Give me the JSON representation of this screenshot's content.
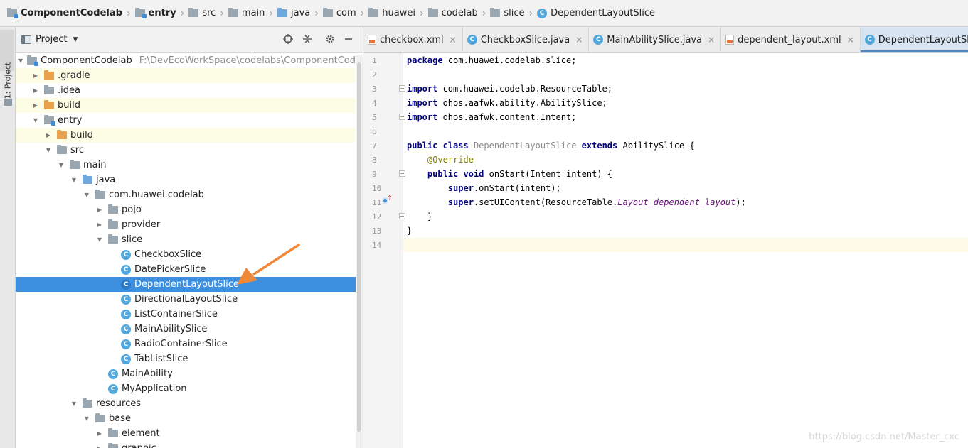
{
  "breadcrumb": [
    {
      "label": "ComponentCodelab",
      "icon": "module-folder-icon",
      "bold": true
    },
    {
      "label": "entry",
      "icon": "module-folder-icon",
      "bold": true
    },
    {
      "label": "src",
      "icon": "folder-icon"
    },
    {
      "label": "main",
      "icon": "folder-icon"
    },
    {
      "label": "java",
      "icon": "source-folder-icon"
    },
    {
      "label": "com",
      "icon": "package-icon"
    },
    {
      "label": "huawei",
      "icon": "package-icon"
    },
    {
      "label": "codelab",
      "icon": "package-icon"
    },
    {
      "label": "slice",
      "icon": "package-icon"
    },
    {
      "label": "DependentLayoutSlice",
      "icon": "class-icon"
    }
  ],
  "left_strip": {
    "label": "1: Project"
  },
  "project_panel": {
    "title": "Project",
    "tree": [
      {
        "label": "ComponentCodelab",
        "path": "F:\\DevEcoWorkSpace\\codelabs\\ComponentCodelab",
        "depth": 0,
        "arrow": "open",
        "icon": "module",
        "highlight": false
      },
      {
        "label": ".gradle",
        "depth": 1,
        "arrow": "closed",
        "icon": "orange",
        "highlight": true
      },
      {
        "label": ".idea",
        "depth": 1,
        "arrow": "closed",
        "icon": "folder",
        "highlight": false
      },
      {
        "label": "build",
        "depth": 1,
        "arrow": "closed",
        "icon": "orange",
        "highlight": true
      },
      {
        "label": "entry",
        "depth": 1,
        "arrow": "open",
        "icon": "module",
        "highlight": false
      },
      {
        "label": "build",
        "depth": 2,
        "arrow": "closed",
        "icon": "orange",
        "highlight": true
      },
      {
        "label": "src",
        "depth": 2,
        "arrow": "open",
        "icon": "folder",
        "highlight": false
      },
      {
        "label": "main",
        "depth": 3,
        "arrow": "open",
        "icon": "folder",
        "highlight": false
      },
      {
        "label": "java",
        "depth": 4,
        "arrow": "open",
        "icon": "src",
        "highlight": false
      },
      {
        "label": "com.huawei.codelab",
        "depth": 5,
        "arrow": "open",
        "icon": "folder",
        "highlight": false
      },
      {
        "label": "pojo",
        "depth": 6,
        "arrow": "closed",
        "icon": "folder",
        "highlight": false
      },
      {
        "label": "provider",
        "depth": 6,
        "arrow": "closed",
        "icon": "folder",
        "highlight": false
      },
      {
        "label": "slice",
        "depth": 6,
        "arrow": "open",
        "icon": "folder",
        "highlight": false
      },
      {
        "label": "CheckboxSlice",
        "depth": 7,
        "arrow": "none",
        "icon": "class",
        "highlight": false
      },
      {
        "label": "DatePickerSlice",
        "depth": 7,
        "arrow": "none",
        "icon": "class",
        "highlight": false
      },
      {
        "label": "DependentLayoutSlice",
        "depth": 7,
        "arrow": "none",
        "icon": "class",
        "highlight": false,
        "selected": true
      },
      {
        "label": "DirectionalLayoutSlice",
        "depth": 7,
        "arrow": "none",
        "icon": "class",
        "highlight": false
      },
      {
        "label": "ListContainerSlice",
        "depth": 7,
        "arrow": "none",
        "icon": "class",
        "highlight": false
      },
      {
        "label": "MainAbilitySlice",
        "depth": 7,
        "arrow": "none",
        "icon": "class",
        "highlight": false
      },
      {
        "label": "RadioContainerSlice",
        "depth": 7,
        "arrow": "none",
        "icon": "class",
        "highlight": false
      },
      {
        "label": "TabListSlice",
        "depth": 7,
        "arrow": "none",
        "icon": "class",
        "highlight": false
      },
      {
        "label": "MainAbility",
        "depth": 6,
        "arrow": "none",
        "icon": "class",
        "highlight": false
      },
      {
        "label": "MyApplication",
        "depth": 6,
        "arrow": "none",
        "icon": "class",
        "highlight": false
      },
      {
        "label": "resources",
        "depth": 4,
        "arrow": "open",
        "icon": "folder",
        "highlight": false
      },
      {
        "label": "base",
        "depth": 5,
        "arrow": "open",
        "icon": "folder",
        "highlight": false
      },
      {
        "label": "element",
        "depth": 6,
        "arrow": "closed",
        "icon": "folder",
        "highlight": false
      },
      {
        "label": "graphic",
        "depth": 6,
        "arrow": "closed",
        "icon": "folder",
        "highlight": false
      }
    ]
  },
  "tabs": [
    {
      "label": "checkbox.xml",
      "icon": "xml-file-icon",
      "active": false
    },
    {
      "label": "CheckboxSlice.java",
      "icon": "class-icon",
      "active": false
    },
    {
      "label": "MainAbilitySlice.java",
      "icon": "class-icon",
      "active": false
    },
    {
      "label": "dependent_layout.xml",
      "icon": "xml-file-icon",
      "active": false
    },
    {
      "label": "DependentLayoutSlice.java",
      "icon": "class-icon",
      "active": true
    }
  ],
  "tab_close_glyph": "×",
  "editor": {
    "current_line": 14,
    "lines": [
      [
        {
          "t": "package",
          "c": "kw"
        },
        {
          "t": " com.huawei.codelab.slice;"
        }
      ],
      [],
      [
        {
          "t": "import",
          "c": "kw"
        },
        {
          "t": " com.huawei.codelab.ResourceTable;"
        }
      ],
      [
        {
          "t": "import",
          "c": "kw"
        },
        {
          "t": " ohos.aafwk.ability.AbilitySlice;"
        }
      ],
      [
        {
          "t": "import",
          "c": "kw"
        },
        {
          "t": " ohos.aafwk.content.Intent;"
        }
      ],
      [],
      [
        {
          "t": "public class",
          "c": "kw"
        },
        {
          "t": " "
        },
        {
          "t": "DependentLayoutSlice",
          "c": "cls-gray"
        },
        {
          "t": " "
        },
        {
          "t": "extends",
          "c": "kw"
        },
        {
          "t": " AbilitySlice {"
        }
      ],
      [
        {
          "t": "    "
        },
        {
          "t": "@Override",
          "c": "ann"
        }
      ],
      [
        {
          "t": "    "
        },
        {
          "t": "public void",
          "c": "kw"
        },
        {
          "t": " onStart(Intent intent) {"
        }
      ],
      [
        {
          "t": "        "
        },
        {
          "t": "super",
          "c": "kw"
        },
        {
          "t": ".onStart(intent);"
        }
      ],
      [
        {
          "t": "        "
        },
        {
          "t": "super",
          "c": "kw"
        },
        {
          "t": ".setUIContent(ResourceTable."
        },
        {
          "t": "Layout_dependent_layout",
          "c": "ital"
        },
        {
          "t": ");"
        }
      ],
      [
        {
          "t": "    }"
        }
      ],
      [
        {
          "t": "}"
        }
      ],
      []
    ],
    "fold_lines": [
      3,
      5,
      9,
      12
    ]
  },
  "watermark": "https://blog.csdn.net/Master_cxc",
  "colors": {
    "selection": "#3d8fe0",
    "annotation_arrow": "#f0883a",
    "highlight_row": "#fdfce4"
  }
}
